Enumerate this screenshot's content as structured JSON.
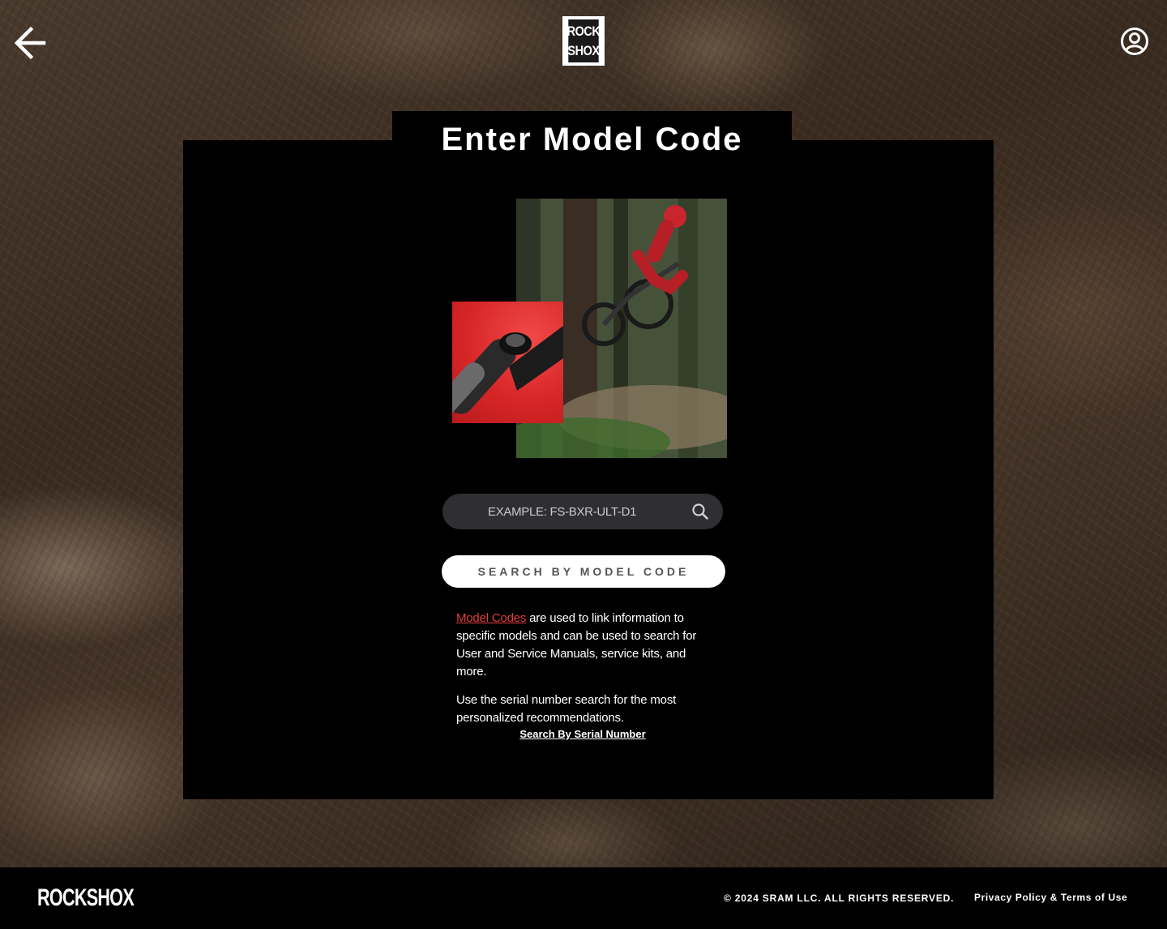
{
  "header": {
    "back_icon": "arrow-left-icon",
    "logo_line1": "ROCK",
    "logo_line2": "SHOX",
    "account_icon": "user-circle-icon"
  },
  "main": {
    "title": "Enter Model Code",
    "search": {
      "placeholder": "EXAMPLE: FS-BXR-ULT-D1",
      "value": "",
      "icon": "search-icon"
    },
    "search_button_label": "SEARCH BY MODEL CODE",
    "info": {
      "link_text": "Model Codes",
      "paragraph1_rest": " are used to link information to specific models and can be used to search for User and Service Manuals, service kits, and more.",
      "paragraph2": "Use the serial number search for the most personalized recommendations."
    },
    "serial_link": "Search By Serial Number"
  },
  "footer": {
    "logo": "ROCKSHOX",
    "copyright": "© 2024 SRAM LLC. ALL RIGHTS RESERVED.",
    "legal_link": "Privacy Policy & Terms of Use"
  },
  "colors": {
    "accent_link": "#e63b3b",
    "card_bg": "#000000",
    "input_bg": "#2e2e33"
  }
}
